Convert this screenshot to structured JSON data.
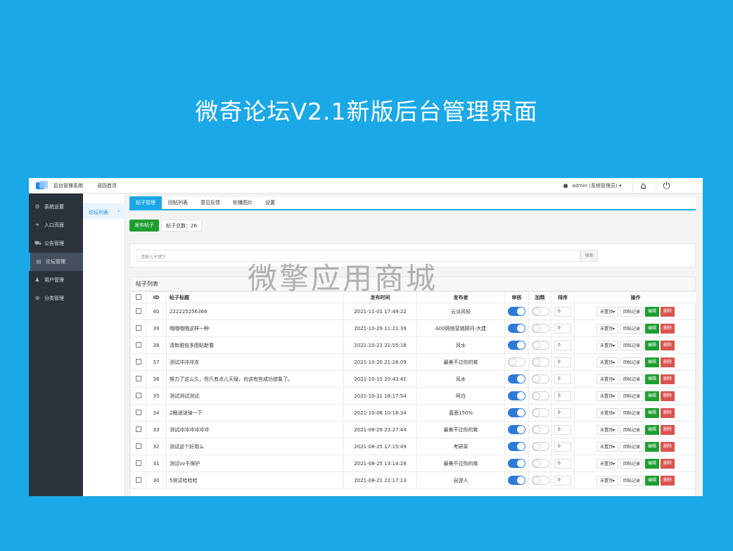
{
  "banner": {
    "title": "微奇论坛V2.1新版后台管理界面"
  },
  "topbar": {
    "system_name": "后台管理系统",
    "back_home": "返回首页",
    "user": "admin (系统管理员) ▾",
    "home_icon": "home-icon",
    "power_icon": "power-icon"
  },
  "sidebar": {
    "items": [
      {
        "label": "系统设置",
        "icon": "gears-icon",
        "glyph": "⚙"
      },
      {
        "label": "入口页面",
        "icon": "link-icon",
        "glyph": "⚭"
      },
      {
        "label": "公告管理",
        "icon": "cart-icon",
        "glyph": "⛟"
      },
      {
        "label": "论坛管理",
        "icon": "list-icon",
        "glyph": "▤"
      },
      {
        "label": "用户管理",
        "icon": "user-icon",
        "glyph": "♟"
      },
      {
        "label": "分类管理",
        "icon": "globe-icon",
        "glyph": "⊕"
      }
    ]
  },
  "subnav": {
    "item": "论坛列表",
    "arrow": "›"
  },
  "tabs": [
    "帖子管理",
    "回帖列表",
    "意见反馈",
    "轮播图片",
    "设置"
  ],
  "toolbar": {
    "post_button": "发布帖子",
    "total_label": "帖子总数：",
    "total": "26"
  },
  "search": {
    "placeholder": "请输入关键字",
    "button": "搜索"
  },
  "list": {
    "title": "帖子列表",
    "headers": {
      "id": "ID",
      "title": "帖子标题",
      "time": "发布时间",
      "author": "发布者",
      "audit": "审核",
      "featured": "加精",
      "sort": "排序",
      "ops": "操作"
    },
    "op_labels": {
      "top": "未置顶▾",
      "replies": "回帖记录",
      "edit": "编辑",
      "del": "删除"
    },
    "rows": [
      {
        "id": "40",
        "title": "222225256366",
        "time": "2021-11-01 17:49:22",
        "author": "云淡风轻",
        "audit": true,
        "featured": false,
        "sort": "0"
      },
      {
        "id": "39",
        "title": "哦哦哦哦这样一种",
        "time": "2021-10-29 11:21:39",
        "author": "A00网络营销顾问-大建",
        "audit": true,
        "featured": false,
        "sort": "0"
      },
      {
        "id": "38",
        "title": "清新脱俗多图贴新春",
        "time": "2021-10-23 21:55:18",
        "author": "风水",
        "audit": true,
        "featured": false,
        "sort": "0"
      },
      {
        "id": "37",
        "title": "测试冲冲冲冻",
        "time": "2021-10-20 21:28:09",
        "author": "最美不过你的笑",
        "audit": false,
        "featured": false,
        "sort": "0"
      },
      {
        "id": "36",
        "title": "努力了这么久，但凡有点儿天赋，也该有些成功迹象了。",
        "time": "2021-10-15 20:43:41",
        "author": "风水",
        "audit": true,
        "featured": false,
        "sort": "0"
      },
      {
        "id": "35",
        "title": "测试测试测试",
        "time": "2021-10-11 18:17:54",
        "author": "阿白",
        "audit": true,
        "featured": false,
        "sort": "0"
      },
      {
        "id": "34",
        "title": "2概谜谜骑一下",
        "time": "2021-10-08 10:16:34",
        "author": "喜面150%",
        "audit": true,
        "featured": false,
        "sort": "0"
      },
      {
        "id": "33",
        "title": "测试冲冲冲冲冲冲",
        "time": "2021-08-29 23:27:44",
        "author": "最美不过你的笑",
        "audit": true,
        "featured": false,
        "sort": "0"
      },
      {
        "id": "32",
        "title": "测试这个好用么",
        "time": "2021-08-25 17:15:49",
        "author": "考研草",
        "audit": true,
        "featured": false,
        "sort": "0"
      },
      {
        "id": "31",
        "title": "测试vv不保护",
        "time": "2021-08-25 13:14:28",
        "author": "最美不过你的笑",
        "audit": true,
        "featured": false,
        "sort": "0"
      },
      {
        "id": "30",
        "title": "5测试哈哈哈",
        "time": "2021-08-21 22:17:13",
        "author": "自游人",
        "audit": true,
        "featured": false,
        "sort": "0"
      }
    ]
  },
  "watermark": "微擎应用商城"
}
